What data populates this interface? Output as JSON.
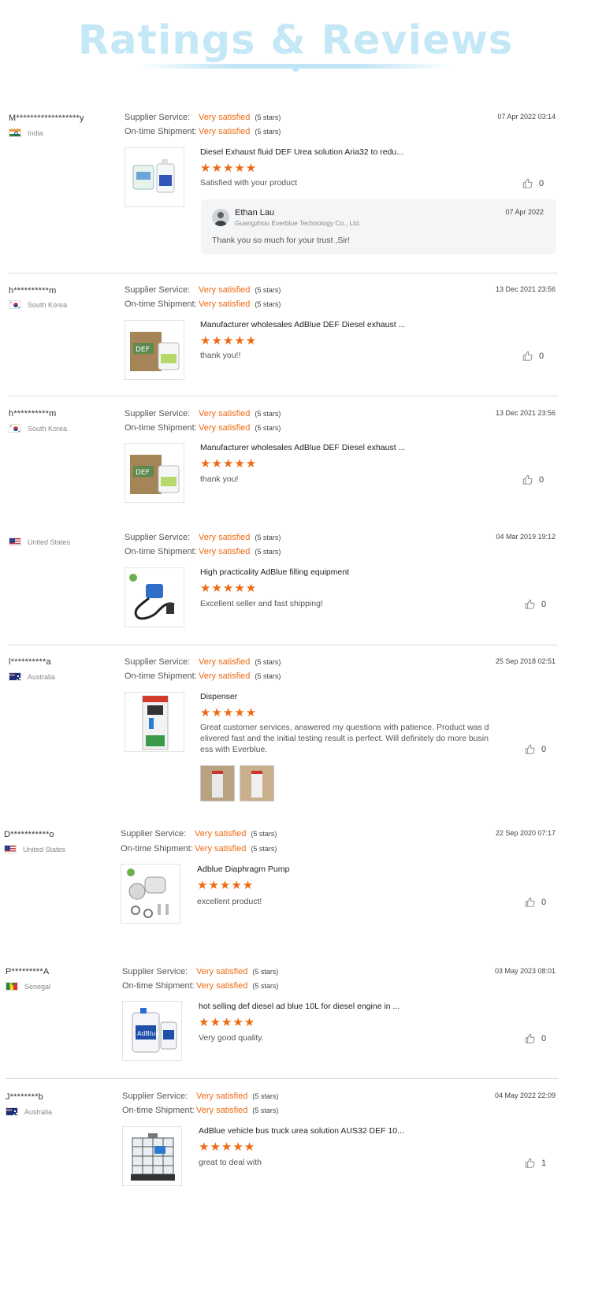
{
  "header": {
    "title": "Ratings & Reviews"
  },
  "labels": {
    "supplier_service": "Supplier Service:",
    "on_time_shipment": "On-time Shipment:",
    "rating_value": "Very satisfied",
    "rating_stars": "(5 stars)"
  },
  "colors": {
    "accent": "#ee6a12",
    "title": "#c5e8f7",
    "divider": "#dcdcdc"
  },
  "reviews": [
    {
      "user": "M******************y",
      "country": "India",
      "flag": "in",
      "date": "07 Apr 2022 03:14",
      "product": "Diesel Exhaust fluid DEF Urea solution Aria32 to redu...",
      "stars": "★★★★★",
      "comment": "Satisfied with your product",
      "likes": "0",
      "thumb_icon": "def-bottles-icon",
      "reply": {
        "name": "Ethan Lau",
        "company": "Guangzhou Everblue Technology Co., Ltd.",
        "date": "07 Apr 2022",
        "text": "Thank you so much for your trust ,Sir!"
      }
    },
    {
      "user": "h**********m",
      "country": "South Korea",
      "flag": "kr",
      "date": "13 Dec 2021 23:56",
      "product": "Manufacturer wholesales AdBlue DEF Diesel exhaust ...",
      "stars": "★★★★★",
      "comment": "thank you!!",
      "likes": "0",
      "thumb_icon": "def-box-icon"
    },
    {
      "user": "h**********m",
      "country": "South Korea",
      "flag": "kr",
      "date": "13 Dec 2021 23:56",
      "product": "Manufacturer wholesales AdBlue DEF Diesel exhaust ...",
      "stars": "★★★★★",
      "comment": "thank you!",
      "likes": "0",
      "thumb_icon": "def-box-icon"
    },
    {
      "user": "",
      "country": "United States",
      "flag": "us",
      "date": "04 Mar 2019 19:12",
      "product": "High practicality AdBlue filling equipment",
      "stars": "★★★★★",
      "comment": "Excellent seller and fast shipping!",
      "likes": "0",
      "thumb_icon": "pump-hose-icon"
    },
    {
      "user": "l**********a",
      "country": "Australia",
      "flag": "au",
      "date": "25 Sep 2018 02:51",
      "product": "Dispenser",
      "stars": "★★★★★",
      "comment": "Great customer services, answered my questions with patience. Product was delivered fast and the initial testing result is perfect. Will definitely do more business with Everblue.",
      "likes": "0",
      "thumb_icon": "dispenser-icon"
    },
    {
      "user": "D***********o",
      "country": "United States",
      "flag": "us",
      "date": "22 Sep 2020 07:17",
      "product": "Adblue Diaphragm Pump",
      "stars": "★★★★★",
      "comment": "excellent product!",
      "likes": "0",
      "thumb_icon": "diaphragm-pump-icon"
    },
    {
      "user": "P*********A",
      "country": "Senegal",
      "flag": "sn",
      "date": "03 May 2023 08:01",
      "product": "hot selling def diesel ad blue 10L for diesel engine in ...",
      "stars": "★★★★★",
      "comment": "Very good quality.",
      "likes": "0",
      "thumb_icon": "adblue-jerrycan-icon"
    },
    {
      "user": "J********b",
      "country": "Australia",
      "flag": "au",
      "date": "04 May 2022 22:09",
      "product": "AdBlue vehicle bus truck urea solution AUS32 DEF 10...",
      "stars": "★★★★★",
      "comment": "great to deal with",
      "likes": "1",
      "thumb_icon": "ibc-tank-icon"
    }
  ]
}
